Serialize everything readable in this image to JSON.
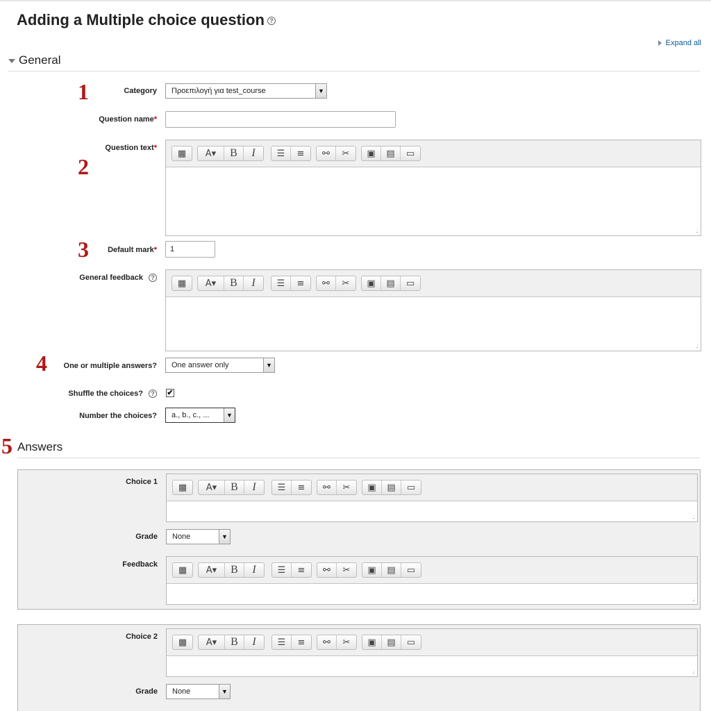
{
  "page": {
    "title": "Adding a Multiple choice question",
    "help_icon": "help-icon",
    "expand_all": "Expand all"
  },
  "sections": {
    "general": "General",
    "answers": "Answers"
  },
  "markers": [
    "1",
    "2",
    "3",
    "4",
    "5"
  ],
  "fields": {
    "category_label": "Category",
    "category_value": "Προεπιλογή για test_course",
    "question_name_label": "Question name",
    "question_name_value": "",
    "question_text_label": "Question text",
    "default_mark_label": "Default mark",
    "default_mark_value": "1",
    "general_feedback_label": "General feedback",
    "one_or_multiple_label": "One or multiple answers?",
    "one_or_multiple_value": "One answer only",
    "shuffle_label": "Shuffle the choices?",
    "shuffle_checked": "✔",
    "number_label": "Number the choices?",
    "number_value": "a., b., c., ..."
  },
  "required_mark": "*",
  "editor_toolbar": {
    "icons": [
      "toggle-toolbar-icon",
      "font-style-icon",
      "bold-icon",
      "italic-icon",
      "bullet-list-icon",
      "numbered-list-icon",
      "link-icon",
      "unlink-icon",
      "image-icon",
      "media-icon",
      "manage-files-icon"
    ],
    "bold": "B",
    "italic": "I"
  },
  "answers": {
    "choice1_label": "Choice 1",
    "choice2_label": "Choice 2",
    "grade_label": "Grade",
    "grade_value": "None",
    "feedback_label": "Feedback"
  }
}
